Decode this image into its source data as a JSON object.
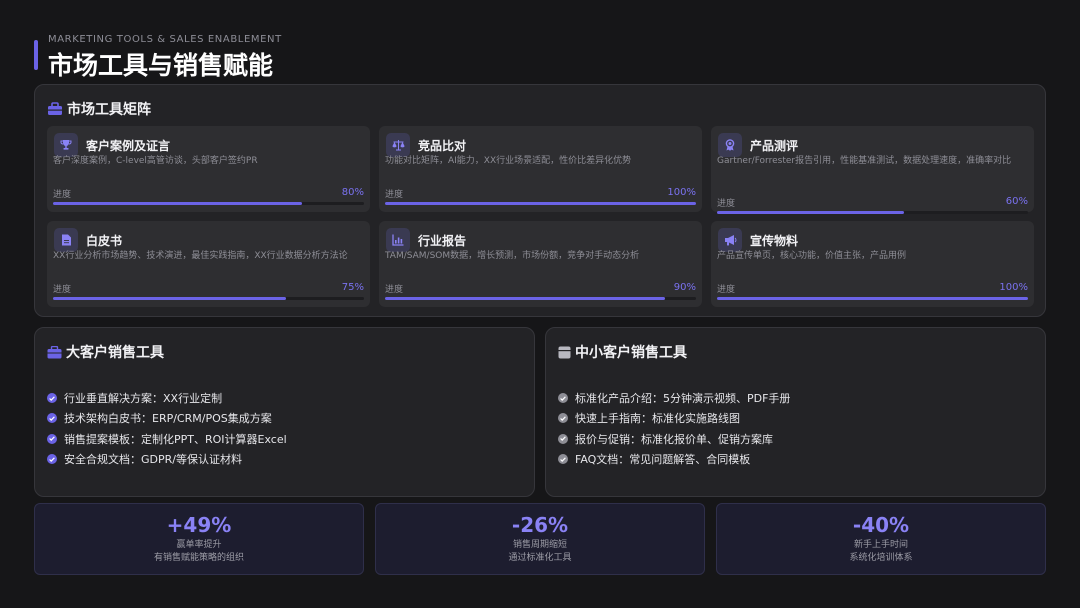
{
  "header": {
    "subtitle": "MARKETING TOOLS & SALES ENABLEMENT",
    "title": "市场工具与销售赋能"
  },
  "matrix": {
    "title": "市场工具矩阵",
    "cards": [
      {
        "title": "客户案例及证言",
        "icon": "trophy-icon",
        "desc": "客户深度案例，C-level高管访谈，头部客户签约PR",
        "progress_label": "进度",
        "progress_text": "80%",
        "progress": 0.8
      },
      {
        "title": "竞品比对",
        "icon": "scale-icon",
        "desc": "功能对比矩阵，AI能力，XX行业场景适配，性价比差异化优势",
        "progress_label": "进度",
        "progress_text": "100%",
        "progress": 1.0
      },
      {
        "title": "产品测评",
        "icon": "award-icon",
        "desc": "Gartner/Forrester报告引用，性能基准测试，数据处理速度，准确率对比",
        "progress_label": "进度",
        "progress_text": "60%",
        "progress": 0.6
      },
      {
        "title": "白皮书",
        "icon": "document-icon",
        "desc": "XX行业分析市场趋势、技术演进，最佳实践指南，XX行业数据分析方法论",
        "progress_label": "进度",
        "progress_text": "75%",
        "progress": 0.75
      },
      {
        "title": "行业报告",
        "icon": "chart-icon",
        "desc": "TAM/SAM/SOM数据，增长预测，市场份额，竞争对手动态分析",
        "progress_label": "进度",
        "progress_text": "90%",
        "progress": 0.9
      },
      {
        "title": "宣传物料",
        "icon": "megaphone-icon",
        "desc": "产品宣传单页，核心功能，价值主张，产品用例",
        "progress_label": "进度",
        "progress_text": "100%",
        "progress": 1.0
      }
    ]
  },
  "enterprise": {
    "title": "大客户销售工具",
    "icon": "briefcase-icon",
    "check_color": "#6b63e6",
    "items": [
      "行业垂直解决方案：XX行业定制",
      "技术架构白皮书：ERP/CRM/POS集成方案",
      "销售提案模板：定制化PPT、ROI计算器Excel",
      "安全合规文档：GDPR/等保认证材料"
    ]
  },
  "smb": {
    "title": "中小客户销售工具",
    "icon": "store-icon",
    "check_color": "#8e8e96",
    "items": [
      "标准化产品介绍：5分钟演示视频、PDF手册",
      "快速上手指南：标准化实施路线图",
      "报价与促销：标准化报价单、促销方案库",
      "FAQ文档：常见问题解答、合同模板"
    ]
  },
  "stats": [
    {
      "value": "+49%",
      "label": "赢单率提升",
      "sub": "有销售赋能策略的组织"
    },
    {
      "value": "-26%",
      "label": "销售周期缩短",
      "sub": "通过标准化工具"
    },
    {
      "value": "-40%",
      "label": "新手上手时间",
      "sub": "系统化培训体系"
    }
  ],
  "colors": {
    "accent": "#6b63e6",
    "background": "#161618",
    "panel": "#232326"
  }
}
